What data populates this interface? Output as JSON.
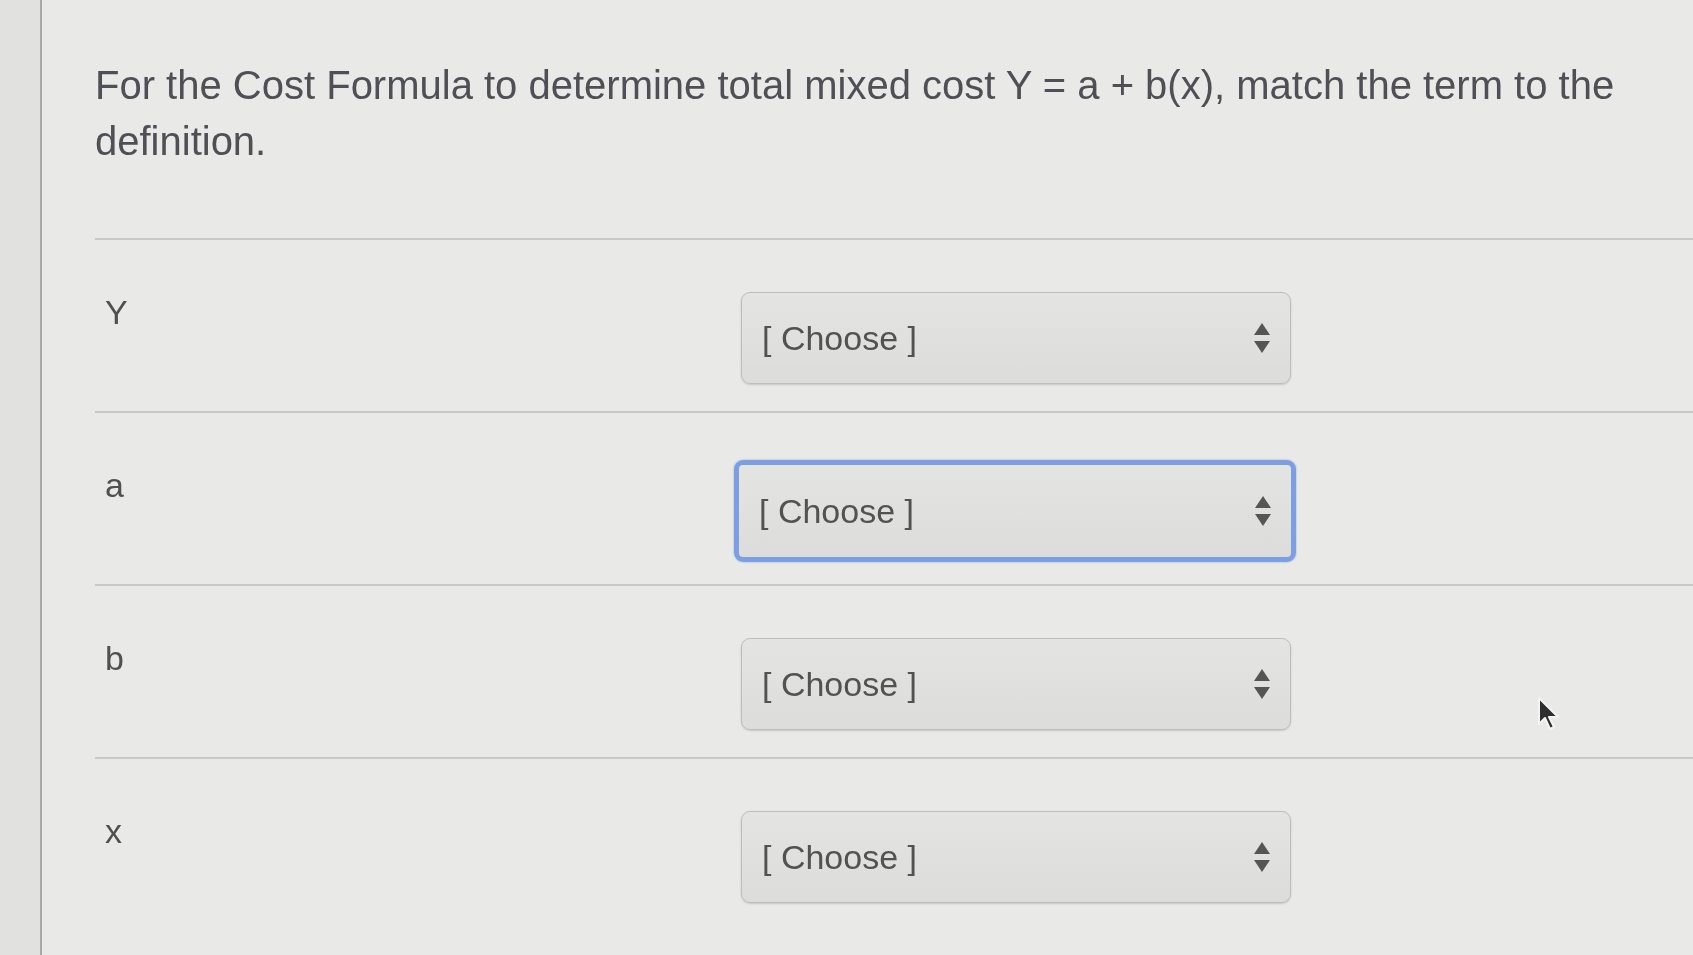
{
  "question": {
    "text": "For the Cost Formula to determine total mixed cost Y = a + b(x), match the term to the definition."
  },
  "matches": [
    {
      "term": "Y",
      "select": {
        "value": "[ Choose ]",
        "focused": false
      }
    },
    {
      "term": "a",
      "select": {
        "value": "[ Choose ]",
        "focused": true
      }
    },
    {
      "term": "b",
      "select": {
        "value": "[ Choose ]",
        "focused": false
      }
    },
    {
      "term": "x",
      "select": {
        "value": "[ Choose ]",
        "focused": false
      }
    }
  ]
}
